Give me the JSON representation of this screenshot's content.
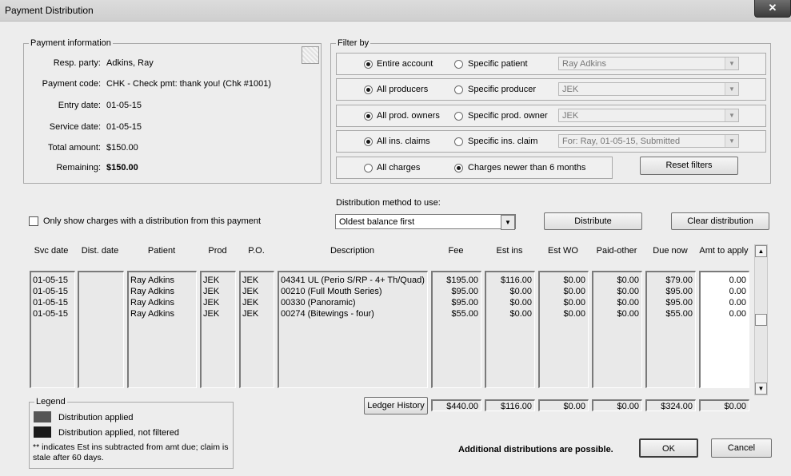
{
  "window": {
    "title": "Payment Distribution",
    "close_label": "✕"
  },
  "payment_info": {
    "legend": "Payment information",
    "fields": [
      {
        "label": "Resp. party:",
        "value": "Adkins, Ray"
      },
      {
        "label": "Payment code:",
        "value": "CHK - Check pmt: thank you! (Chk #1001)"
      },
      {
        "label": "Entry date:",
        "value": "01-05-15"
      },
      {
        "label": "Service date:",
        "value": "01-05-15"
      },
      {
        "label": "Total amount:",
        "value": "$150.00"
      },
      {
        "label": "Remaining:",
        "value": "$150.00"
      }
    ]
  },
  "filter": {
    "legend": "Filter by",
    "rows": [
      {
        "opt_a": "Entire account",
        "opt_b": "Specific patient",
        "selected": "a",
        "combo": "Ray Adkins"
      },
      {
        "opt_a": "All producers",
        "opt_b": "Specific producer",
        "selected": "a",
        "combo": "JEK"
      },
      {
        "opt_a": "All prod. owners",
        "opt_b": "Specific prod. owner",
        "selected": "a",
        "combo": "JEK"
      },
      {
        "opt_a": "All ins. claims",
        "opt_b": "Specific ins. claim",
        "selected": "a",
        "combo": "For: Ray, 01-05-15, Submitted"
      },
      {
        "opt_a": "All charges",
        "opt_b": "Charges newer than 6 months",
        "selected": "b"
      }
    ],
    "reset_label": "Reset filters"
  },
  "distribution": {
    "method_label": "Distribution method to use:",
    "method_value": "Oldest balance first",
    "checkbox_label": "Only show charges with a distribution from this payment",
    "distribute_label": "Distribute",
    "clear_label": "Clear distribution"
  },
  "table": {
    "headers": {
      "svc_date": "Svc date",
      "dist_date": "Dist. date",
      "patient": "Patient",
      "prod": "Prod",
      "po": "P.O.",
      "description": "Description",
      "fee": "Fee",
      "est_ins": "Est ins",
      "est_wo": "Est WO",
      "paid_other": "Paid-other",
      "due_now": "Due now",
      "amt_to_apply": "Amt to apply"
    },
    "rows": [
      {
        "svc_date": "01-05-15",
        "dist_date": "",
        "patient": "Ray Adkins",
        "prod": "JEK",
        "po": "JEK",
        "description": "04341 UL (Perio S/RP - 4+ Th/Quad)",
        "fee": "$195.00",
        "est_ins": "$116.00",
        "est_wo": "$0.00",
        "paid_other": "$0.00",
        "due_now": "$79.00",
        "amt_to_apply": "0.00"
      },
      {
        "svc_date": "01-05-15",
        "dist_date": "",
        "patient": "Ray Adkins",
        "prod": "JEK",
        "po": "JEK",
        "description": "00210 (Full Mouth Series)",
        "fee": "$95.00",
        "est_ins": "$0.00",
        "est_wo": "$0.00",
        "paid_other": "$0.00",
        "due_now": "$95.00",
        "amt_to_apply": "0.00"
      },
      {
        "svc_date": "01-05-15",
        "dist_date": "",
        "patient": "Ray Adkins",
        "prod": "JEK",
        "po": "JEK",
        "description": "00330 (Panoramic)",
        "fee": "$95.00",
        "est_ins": "$0.00",
        "est_wo": "$0.00",
        "paid_other": "$0.00",
        "due_now": "$95.00",
        "amt_to_apply": "0.00"
      },
      {
        "svc_date": "01-05-15",
        "dist_date": "",
        "patient": "Ray Adkins",
        "prod": "JEK",
        "po": "JEK",
        "description": "00274 (Bitewings - four)",
        "fee": "$55.00",
        "est_ins": "$0.00",
        "est_wo": "$0.00",
        "paid_other": "$0.00",
        "due_now": "$55.00",
        "amt_to_apply": "0.00"
      }
    ],
    "totals": {
      "fee": "$440.00",
      "est_ins": "$116.00",
      "est_wo": "$0.00",
      "paid_other": "$0.00",
      "due_now": "$324.00",
      "amt_to_apply": "$0.00"
    },
    "ledger_label": "Ledger History"
  },
  "legend": {
    "title": "Legend",
    "applied": "Distribution applied",
    "applied_not_filtered": "Distribution applied, not filtered",
    "note": "** indicates Est ins subtracted from amt due; claim is stale after 60 days.",
    "applied_color": "#555555",
    "not_filtered_color": "#1a1a1a"
  },
  "footer": {
    "status": "Additional distributions are possible.",
    "ok_label": "OK",
    "cancel_label": "Cancel"
  }
}
